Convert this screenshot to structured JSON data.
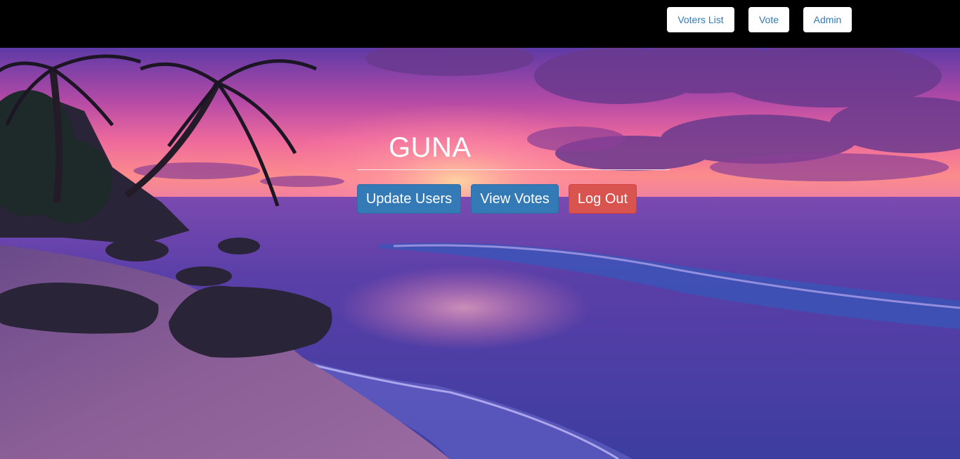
{
  "nav": {
    "voters_list": "Voters List",
    "vote": "Vote",
    "admin": "Admin"
  },
  "main": {
    "title": "GUNA",
    "update_users": "Update Users",
    "view_votes": "View Votes",
    "log_out": "Log Out"
  },
  "colors": {
    "nav_background": "#000000",
    "nav_button_text": "#337ab7",
    "primary_button": "#337ab7",
    "danger_button": "#d9534f"
  },
  "background_image": "tropical-beach-sunset"
}
